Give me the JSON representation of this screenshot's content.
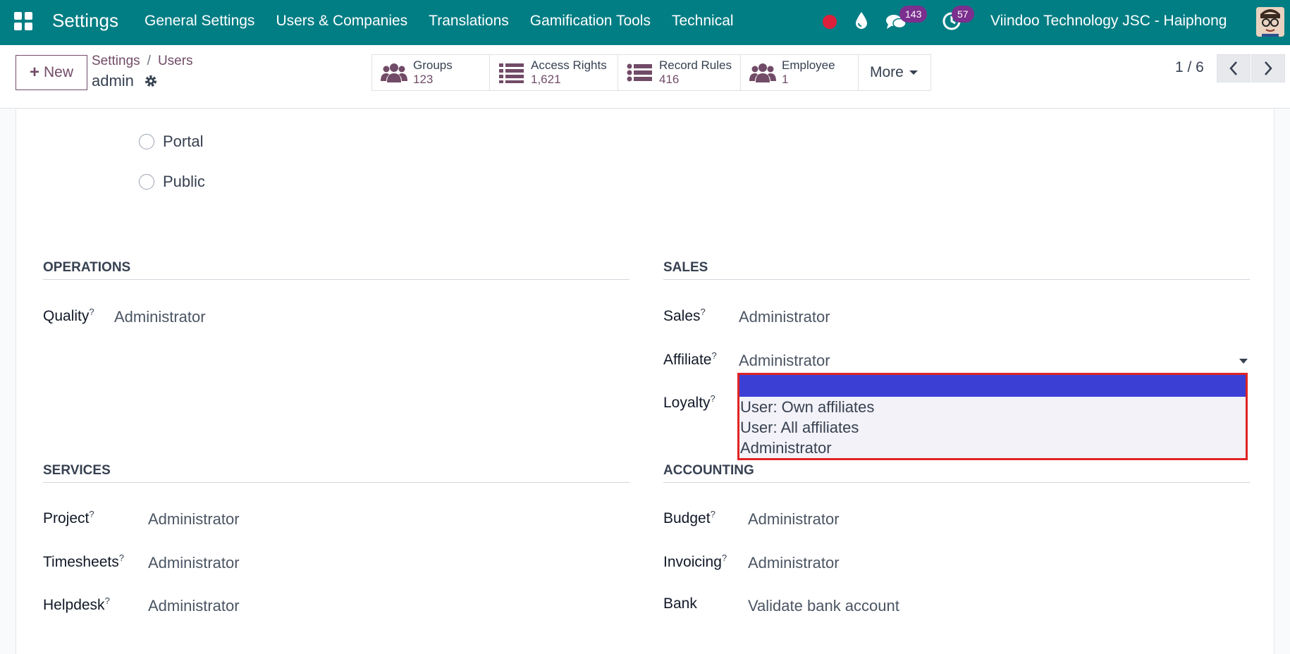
{
  "navbar": {
    "brand": "Settings",
    "menu": [
      "General Settings",
      "Users & Companies",
      "Translations",
      "Gamification Tools",
      "Technical"
    ],
    "chat_count": "143",
    "activity_count": "57",
    "company": "Viindoo Technology JSC - Haiphong",
    "colors": {
      "bar": "#017e84",
      "badge": "#7b2f8e",
      "record": "#dc1f3a"
    }
  },
  "control": {
    "new_label": "New",
    "breadcrumb": {
      "parent": "Settings",
      "sep": "/",
      "current": "Users"
    },
    "record_name": "admin",
    "smart_buttons": [
      {
        "label": "Groups",
        "value": "123",
        "icon": "users-icon"
      },
      {
        "label": "Access Rights",
        "value": "1,621",
        "icon": "list-icon"
      },
      {
        "label": "Record Rules",
        "value": "416",
        "icon": "list-icon"
      },
      {
        "label": "Employee",
        "value": "1",
        "icon": "users-icon"
      }
    ],
    "more_label": "More",
    "pager": "1 / 6"
  },
  "form": {
    "user_types": [
      "Portal",
      "Public"
    ],
    "operations": {
      "title": "OPERATIONS",
      "fields": [
        {
          "label": "Quality",
          "help": "?",
          "value": "Administrator"
        }
      ]
    },
    "sales": {
      "title": "SALES",
      "fields": [
        {
          "label": "Sales",
          "help": "?",
          "value": "Administrator"
        },
        {
          "label": "Affiliate",
          "help": "?",
          "value": "Administrator"
        },
        {
          "label": "Loyalty",
          "help": "?",
          "value": ""
        }
      ]
    },
    "affiliate_dropdown": {
      "options": [
        "",
        "User: Own affiliates",
        "User: All affiliates",
        "Administrator"
      ],
      "highlight_color": "#3c3fd4",
      "outline_color": "#e02424"
    },
    "services": {
      "title": "SERVICES",
      "fields": [
        {
          "label": "Project",
          "help": "?",
          "value": "Administrator"
        },
        {
          "label": "Timesheets",
          "help": "?",
          "value": "Administrator"
        },
        {
          "label": "Helpdesk",
          "help": "?",
          "value": "Administrator"
        }
      ]
    },
    "accounting": {
      "title": "ACCOUNTING",
      "fields": [
        {
          "label": "Budget",
          "help": "?",
          "value": "Administrator"
        },
        {
          "label": "Invoicing",
          "help": "?",
          "value": "Administrator"
        },
        {
          "label": "Bank",
          "help": "",
          "value": "Validate bank account"
        }
      ]
    }
  }
}
